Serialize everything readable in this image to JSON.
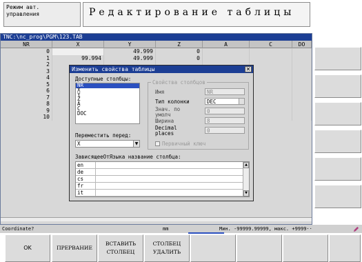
{
  "header": {
    "mode": "Режим авт.\nуправления",
    "title": "Редактирование таблицы"
  },
  "table": {
    "path": "TNC:\\nc_prog\\PGM\\123.TAB",
    "columns": [
      "NR",
      "X",
      "Y",
      "Z",
      "A",
      "C",
      "DO"
    ],
    "rows": [
      [
        "0",
        "",
        "49.999",
        "0",
        "",
        "",
        ""
      ],
      [
        "1",
        "99.994",
        "49.999",
        "0",
        "",
        "",
        ""
      ],
      [
        "2",
        "",
        "",
        "",
        "",
        "",
        ""
      ],
      [
        "3",
        "",
        "",
        "",
        "",
        "",
        ""
      ],
      [
        "4",
        "",
        "",
        "",
        "",
        "",
        ""
      ],
      [
        "5",
        "",
        "",
        "",
        "",
        "",
        ""
      ],
      [
        "6",
        "",
        "",
        "",
        "",
        "",
        ""
      ],
      [
        "7",
        "",
        "",
        "",
        "",
        "",
        ""
      ],
      [
        "8",
        "",
        "",
        "",
        "",
        "",
        ""
      ],
      [
        "9",
        "",
        "",
        "",
        "",
        "",
        ""
      ],
      [
        "10",
        "",
        "",
        "",
        "",
        "",
        ""
      ]
    ]
  },
  "dialog": {
    "title": "Изменить свойства таблицы",
    "close": "✕",
    "available_label": "Доступные столбцы:",
    "available_columns": [
      "NR",
      "X",
      "Y",
      "Z",
      "A",
      "C",
      "DOC"
    ],
    "selected_column": "NR",
    "properties_legend": "Свойства столбцов",
    "properties": {
      "name_label": "Имя",
      "name_value": "NR",
      "type_label": "Тип колонки",
      "type_value": "DEC",
      "default_label": "Знач. по\nумолч",
      "default_value": "0",
      "width_label": "Ширина",
      "width_value": "8",
      "decimal_label": "Decimal\nplaces",
      "decimal_value": "0",
      "primary_key_label": "Первичный ключ"
    },
    "move_before_label": "Переместить перед:",
    "move_before_value": "X",
    "lang_label": "ЗависящееОтЯзыка название столбца:",
    "languages": [
      "en",
      "de",
      "cs",
      "fr",
      "it"
    ]
  },
  "status": {
    "prompt": "Coordinate?",
    "unit": "mm",
    "range": "Мин. -99999.99999, макс. +9999··"
  },
  "softkeys": {
    "ok": "OK",
    "abort": "ПРЕРВАНИЕ",
    "insert_line1": "ВСТАВИТЬ",
    "insert_line2": "СТОЛБЕЦ",
    "delete_line1": "СТОЛБЕЦ",
    "delete_line2": "УДАЛИТЬ"
  },
  "colors": {
    "titlebar": "#1c3e94",
    "selection": "#2b50c0",
    "panel": "#d8d8d8"
  }
}
